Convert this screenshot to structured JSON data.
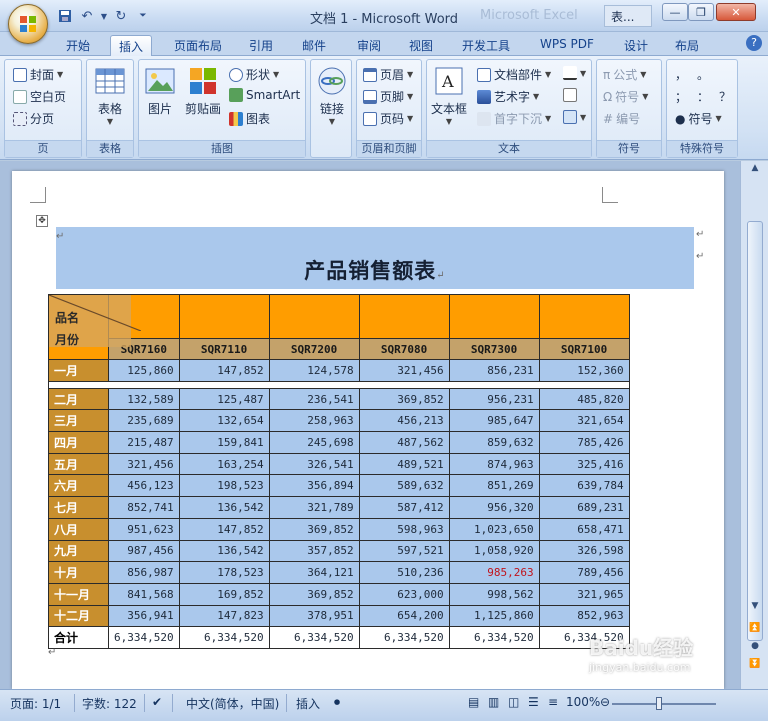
{
  "window": {
    "title": "文档 1 - Microsoft Word",
    "ghost_title": "Microsoft Excel",
    "taskbar_button": "表..."
  },
  "tabs": [
    "开始",
    "插入",
    "页面布局",
    "引用",
    "邮件",
    "审阅",
    "视图",
    "开发工具",
    "WPS PDF",
    "设计",
    "布局"
  ],
  "active_tab": "插入",
  "ribbon": {
    "groups": {
      "pages": "页",
      "tables": "表格",
      "illustrations": "插图",
      "links": "",
      "header_footer": "页眉和页脚",
      "text": "文本",
      "symbols": "符号",
      "special": "特殊符号"
    },
    "pages": [
      "封面",
      "空白页",
      "分页"
    ],
    "table": "表格",
    "picture": "图片",
    "clipart": "剪贴画",
    "shapes": "形状",
    "smartart": "SmartArt",
    "chart": "图表",
    "link": "链接",
    "header_footer_items": [
      "页眉",
      "页脚",
      "页码"
    ],
    "textbox": "文本框",
    "text_items": [
      "文档部件",
      "艺术字",
      "首字下沉"
    ],
    "symbol_items": [
      "公式",
      "符号",
      "编号"
    ],
    "special_chars": [
      "，",
      "。",
      "；",
      "：",
      "？",
      "符号"
    ]
  },
  "document": {
    "heading": "产品销售额表",
    "corner_top": "品名",
    "corner_bottom": "月份",
    "products": [
      "SQR7160",
      "SQR7110",
      "SQR7200",
      "SQR7080",
      "SQR7300",
      "SQR7100"
    ],
    "months": [
      "一月",
      "二月",
      "三月",
      "四月",
      "五月",
      "六月",
      "七月",
      "八月",
      "九月",
      "十月",
      "十一月",
      "十二月"
    ],
    "rows": [
      [
        "125,860",
        "147,852",
        "124,578",
        "321,456",
        "856,231",
        "152,360"
      ],
      [
        "132,589",
        "125,487",
        "236,541",
        "369,852",
        "956,231",
        "485,820"
      ],
      [
        "235,689",
        "132,654",
        "258,963",
        "456,213",
        "985,647",
        "321,654"
      ],
      [
        "215,487",
        "159,841",
        "245,698",
        "487,562",
        "859,632",
        "785,426"
      ],
      [
        "321,456",
        "163,254",
        "326,541",
        "489,521",
        "874,963",
        "325,416"
      ],
      [
        "456,123",
        "198,523",
        "356,894",
        "589,632",
        "851,269",
        "639,784"
      ],
      [
        "852,741",
        "136,542",
        "321,789",
        "587,412",
        "956,320",
        "689,231"
      ],
      [
        "951,623",
        "147,852",
        "369,852",
        "598,963",
        "1,023,650",
        "658,471"
      ],
      [
        "987,456",
        "136,542",
        "357,852",
        "597,521",
        "1,058,920",
        "326,598"
      ],
      [
        "856,987",
        "178,523",
        "364,121",
        "510,236",
        "985,263",
        "789,456"
      ],
      [
        "841,568",
        "169,852",
        "369,852",
        "623,000",
        "998,562",
        "321,965"
      ],
      [
        "356,941",
        "147,823",
        "378,951",
        "654,200",
        "1,125,860",
        "852,963"
      ]
    ],
    "total_label": "合计",
    "totals": [
      "6,334,520",
      "6,334,520",
      "6,334,520",
      "6,334,520",
      "6,334,520",
      "6,334,520"
    ],
    "highlight_color": "#c0141c"
  },
  "status": {
    "page": "页面: 1/1",
    "words": "字数: 122",
    "language": "中文(简体，中国)",
    "mode": "插入",
    "zoom": "100%"
  },
  "watermark": {
    "brand": "Baidu经验",
    "url": "jingyan.baidu.com"
  }
}
